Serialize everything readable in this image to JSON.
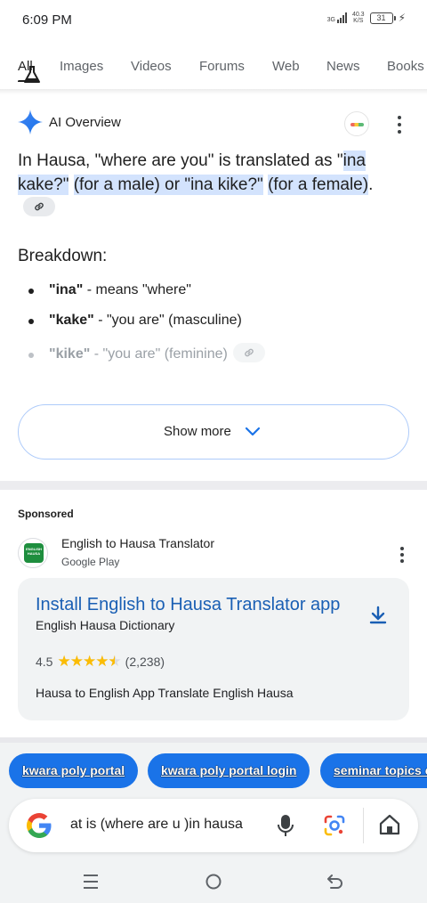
{
  "status": {
    "time": "6:09 PM",
    "network": "3G",
    "speed_value": "40.3",
    "speed_unit": "K/S",
    "battery": "31"
  },
  "tabs": [
    "All",
    "Images",
    "Videos",
    "Forums",
    "Web",
    "News",
    "Books"
  ],
  "ai": {
    "title": "AI Overview",
    "intro_prefix": "In Hausa, \"where are you\" is translated as \"",
    "hl1": "ina kake?\"",
    "hl2": "(for a male) or \"ina kike?\"",
    "hl3": "(for a female)",
    "period": ".",
    "breakdown": "Breakdown:",
    "items": [
      {
        "term": "\"ina\"",
        "desc": " - means \"where\""
      },
      {
        "term": "\"kake\"",
        "desc": " - \"you are\" (masculine)"
      },
      {
        "term": "\"kike\"",
        "desc": " - \"you are\" (feminine)"
      }
    ],
    "show_more": "Show more"
  },
  "ad": {
    "sponsored": "Sponsored",
    "logo_text": "ENGLISH HAUSA",
    "advertiser": "English to Hausa Translator",
    "store": "Google Play",
    "title": "Install English to Hausa Translator app",
    "subtitle": "English Hausa Dictionary",
    "rating_value": "4.5",
    "rating_fraction": 0.9,
    "rating_count": "(2,238)",
    "description": "Hausa to English App Translate English Hausa"
  },
  "chips": [
    "kwara poly portal",
    "kwara poly portal login",
    "seminar topics c"
  ],
  "search": {
    "query": "at is (where are u )in hausa"
  },
  "colors": {
    "accent": "#1a73e8",
    "highlight": "#d3e3fd",
    "star": "#fbbc04"
  }
}
